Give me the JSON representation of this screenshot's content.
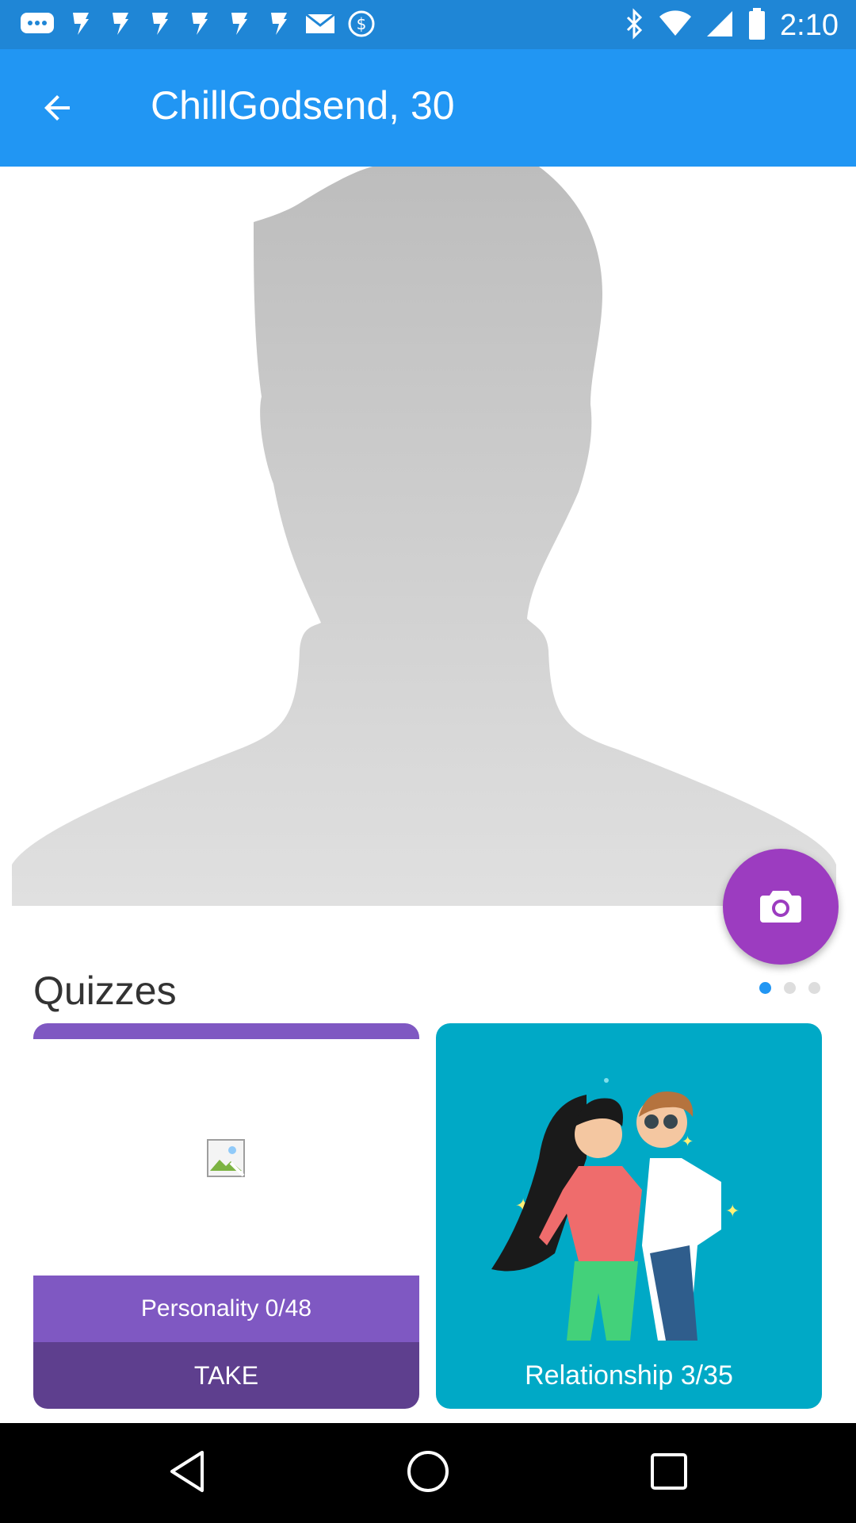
{
  "status_bar": {
    "time": "2:10",
    "left_icons": [
      "message-icon",
      "fan-icon",
      "fan-icon",
      "fan-icon",
      "fan-icon",
      "fan-icon",
      "fan-icon",
      "email-icon",
      "dollar-icon"
    ],
    "right_icons": [
      "bluetooth-icon",
      "wifi-icon",
      "signal-icon",
      "battery-icon"
    ]
  },
  "header": {
    "title": "ChillGodsend, 30",
    "back_icon": "arrow-back-icon"
  },
  "profile": {
    "photo_placeholder": "silhouette-avatar",
    "camera_icon": "camera-icon",
    "colors": {
      "fab": "#9c3cc0",
      "silhouette": "#c4c4c4"
    }
  },
  "quizzes": {
    "heading": "Quizzes",
    "pager": {
      "count": 3,
      "active": 0
    },
    "cards": [
      {
        "label": "Personality 0/48",
        "action": "TAKE",
        "color": "#7f58c2"
      },
      {
        "label": "Relationship 3/35",
        "color": "#00a9c6"
      }
    ]
  },
  "nav_bar": {
    "buttons": [
      "back-triangle-icon",
      "home-circle-icon",
      "recents-square-icon"
    ]
  },
  "colors": {
    "app_bar": "#2196f3",
    "status_bar": "#1f86d6"
  }
}
